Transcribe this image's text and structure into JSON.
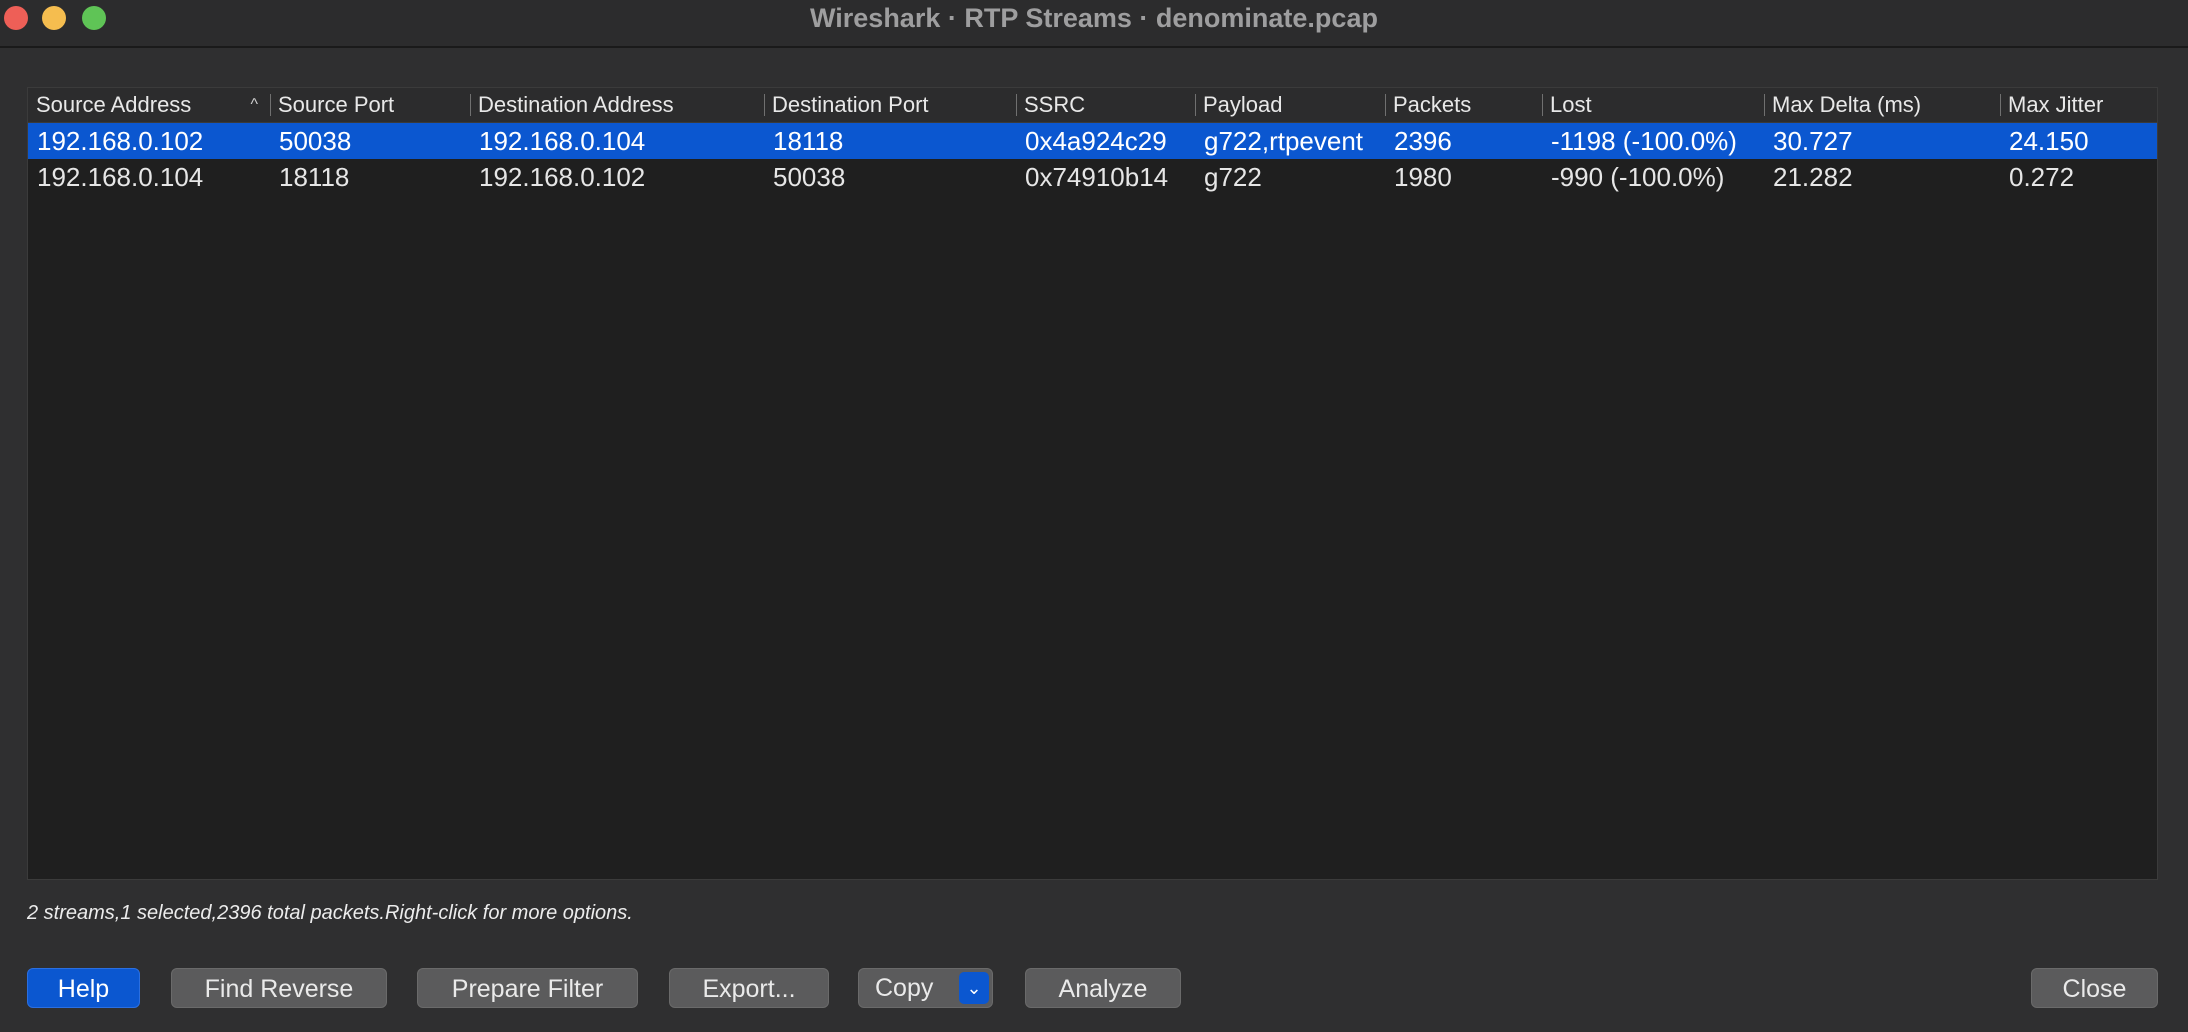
{
  "window": {
    "title": "Wireshark · RTP Streams · denominate.pcap"
  },
  "table": {
    "columns": [
      "Source Address",
      "Source Port",
      "Destination Address",
      "Destination Port",
      "SSRC",
      "Payload",
      "Packets",
      "Lost",
      "Max Delta (ms)",
      "Max Jitter"
    ],
    "sort_icon": "sort-ascending-icon",
    "rows": [
      {
        "selected": true,
        "cells": [
          "192.168.0.102",
          "50038",
          "192.168.0.104",
          "18118",
          "0x4a924c29",
          "g722,rtpevent",
          "2396",
          "-1198 (-100.0%)",
          "30.727",
          "24.150"
        ]
      },
      {
        "selected": false,
        "cells": [
          "192.168.0.104",
          "18118",
          "192.168.0.102",
          "50038",
          "0x74910b14",
          "g722",
          "1980",
          "-990 (-100.0%)",
          "21.282",
          "0.272"
        ]
      }
    ]
  },
  "status": {
    "text": "2 streams,1 selected,2396 total packets.Right-click for more options."
  },
  "buttons": {
    "help": "Help",
    "find_reverse": "Find Reverse",
    "prepare_filter": "Prepare Filter",
    "export": "Export...",
    "copy": "Copy",
    "analyze": "Analyze",
    "close": "Close"
  },
  "colors": {
    "accent": "#0b57d0",
    "background": "#2f2f30",
    "table_background": "#1f1f1f"
  }
}
